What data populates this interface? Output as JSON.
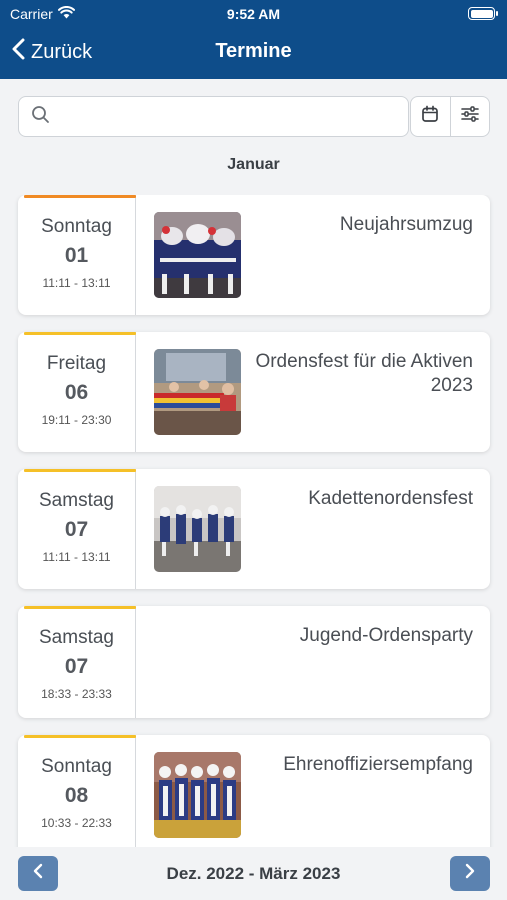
{
  "status_bar": {
    "carrier": "Carrier",
    "time": "9:52 AM"
  },
  "nav": {
    "back_label": "Zurück",
    "title": "Termine"
  },
  "search": {
    "placeholder": "",
    "value": ""
  },
  "month_header": "Januar",
  "events": [
    {
      "weekday": "Sonntag",
      "day": "01",
      "time": "11:11 - 13:11",
      "title": "Neujahrsumzug",
      "accent_color": "#f08a24",
      "has_image": true
    },
    {
      "weekday": "Freitag",
      "day": "06",
      "time": "19:11 - 23:30",
      "title": "Ordensfest für die Aktiven 2023",
      "accent_color": "#f5c028",
      "has_image": true
    },
    {
      "weekday": "Samstag",
      "day": "07",
      "time": "11:11 - 13:11",
      "title": "Kadettenordensfest",
      "accent_color": "#f5c028",
      "has_image": true
    },
    {
      "weekday": "Samstag",
      "day": "07",
      "time": "18:33 - 23:33",
      "title": "Jugend-Ordensparty",
      "accent_color": "#f5c028",
      "has_image": false
    },
    {
      "weekday": "Sonntag",
      "day": "08",
      "time": "10:33 - 22:33",
      "title": "Ehrenoffiziersempfang",
      "accent_color": "#f5c028",
      "has_image": true
    }
  ],
  "footer": {
    "range_label": "Dez. 2022 - März 2023"
  },
  "colors": {
    "header": "#0e4d8a",
    "pager_button": "#5b82b0"
  },
  "icons": [
    "wifi-icon",
    "battery-icon",
    "chevron-left-icon",
    "search-icon",
    "calendar-icon",
    "filter-sliders-icon",
    "chevron-right-icon"
  ]
}
